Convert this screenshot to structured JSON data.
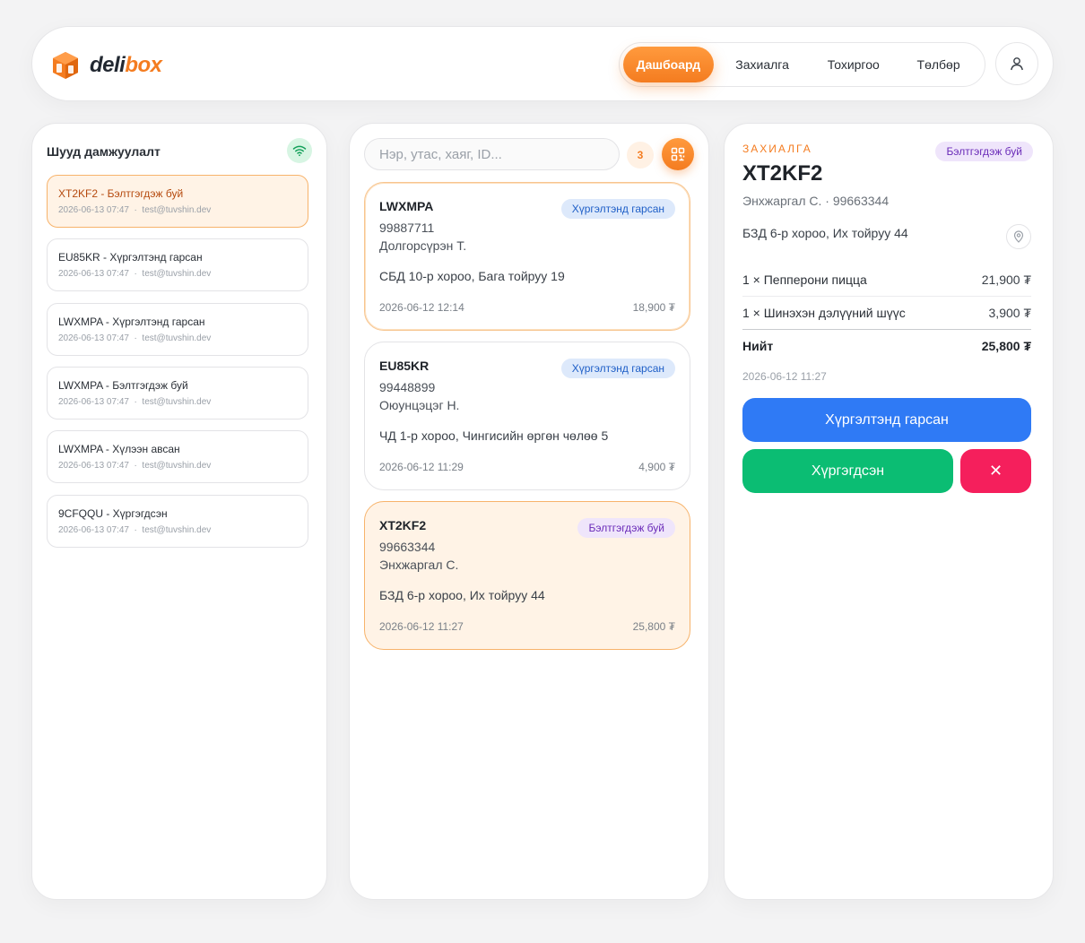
{
  "app": {
    "name_part1": "deli",
    "name_part2": "box",
    "brand_color": "#f47c20"
  },
  "nav": {
    "items": [
      {
        "label": "Дашбоард",
        "active": true
      },
      {
        "label": "Захиалга",
        "active": false
      },
      {
        "label": "Тохиргоо",
        "active": false
      },
      {
        "label": "Төлбөр",
        "active": false
      }
    ],
    "profile_icon": "user-icon"
  },
  "stream": {
    "title": "Шууд дамжуулалт",
    "status_icon": "wifi-icon",
    "events": [
      {
        "title": "XT2KF2 - Бэлтгэгдэж буй",
        "time": "2026-06-13 07:47",
        "email": "test@tuvshin.dev",
        "active": true
      },
      {
        "title": "EU85KR - Хүргэлтэнд гарсан",
        "time": "2026-06-13 07:47",
        "email": "test@tuvshin.dev",
        "active": false
      },
      {
        "title": "LWXMPA - Хүргэлтэнд гарсан",
        "time": "2026-06-13 07:47",
        "email": "test@tuvshin.dev",
        "active": false
      },
      {
        "title": "LWXMPA - Бэлтгэгдэж буй",
        "time": "2026-06-13 07:47",
        "email": "test@tuvshin.dev",
        "active": false
      },
      {
        "title": "LWXMPA - Хүлээн авсан",
        "time": "2026-06-13 07:47",
        "email": "test@tuvshin.dev",
        "active": false
      },
      {
        "title": "9CFQQU - Хүргэгдсэн",
        "time": "2026-06-13 07:47",
        "email": "test@tuvshin.dev",
        "active": false
      }
    ]
  },
  "orders": {
    "search_placeholder": "Нэр, утас, хаяг, ID...",
    "count": "3",
    "scan_icon": "qr-icon",
    "list": [
      {
        "id": "LWXMPA",
        "status": "Хүргэлтэнд гарсан",
        "phone": "99887711",
        "name": "Долгорсүрэн Т.",
        "address": "СБД 10-р хороо, Бага тойруу 19",
        "date": "2026-06-12 12:14",
        "price": "18,900 ₮"
      },
      {
        "id": "EU85KR",
        "status": "Хүргэлтэнд гарсан",
        "phone": "99448899",
        "name": "Оюунцэцэг Н.",
        "address": "ЧД 1-р хороо, Чингисийн өргөн чөлөө 5",
        "date": "2026-06-12 11:29",
        "price": "4,900 ₮"
      },
      {
        "id": "XT2KF2",
        "status": "Бэлтгэгдэж буй",
        "phone": "99663344",
        "name": "Энхжаргал С.",
        "address": "БЗД 6-р хороо, Их тойруу 44",
        "date": "2026-06-12 11:27",
        "price": "25,800 ₮"
      }
    ]
  },
  "detail": {
    "label": "ЗАХИАЛГА",
    "status": "Бэлтгэгдэж буй",
    "id": "XT2KF2",
    "customer": "Энхжаргал С. · 99663344",
    "address": "БЗД 6-р хороо, Их тойруу 44",
    "pin_icon": "location-pin-icon",
    "items": [
      {
        "name": "1 × Пепперони пицца",
        "price": "21,900 ₮"
      },
      {
        "name": "1 × Шинэхэн дэлүүний шүүс",
        "price": "3,900 ₮"
      }
    ],
    "total_label": "Нийт",
    "total_value": "25,800 ₮",
    "date": "2026-06-12 11:27",
    "btn_dispatch": "Хүргэлтэнд гарсан",
    "btn_delivered": "Хүргэгдсэн",
    "btn_cancel": "✕",
    "colors": {
      "dispatch": "#2f7af5",
      "delivered": "#0bbd73",
      "cancel": "#f51f5c"
    }
  }
}
